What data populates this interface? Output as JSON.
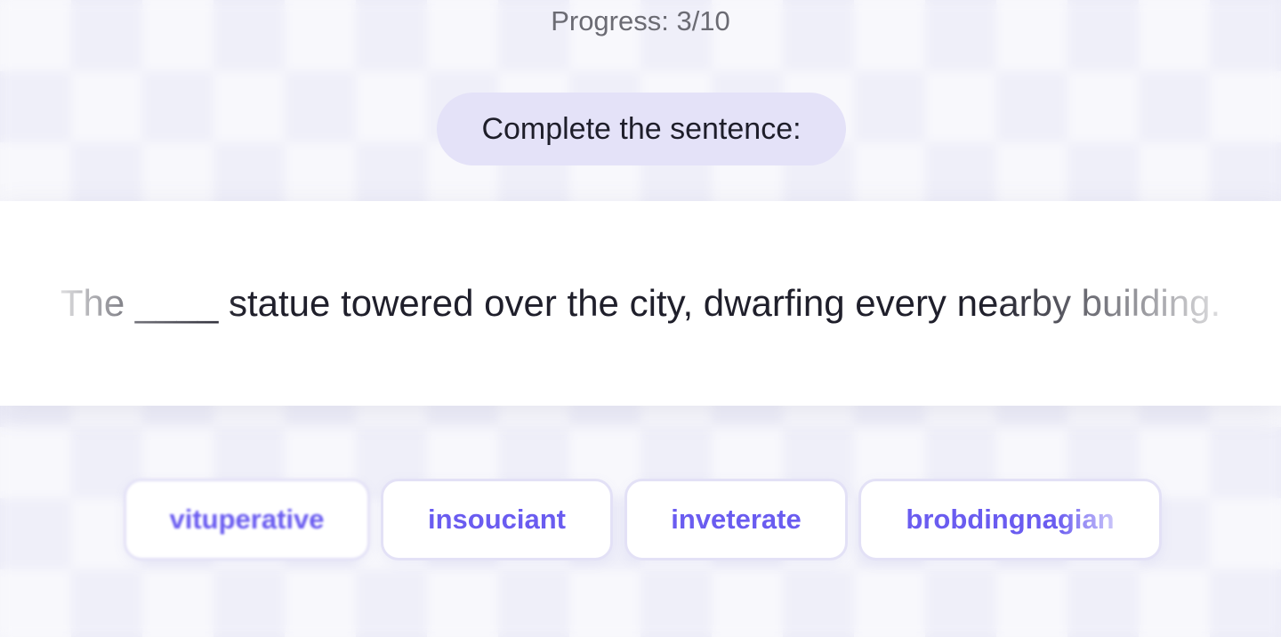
{
  "progress": {
    "text": "Progress: 3/10",
    "current": 3,
    "total": 10
  },
  "prompt": {
    "instruction": "Complete the sentence:"
  },
  "sentence": {
    "text": "The ____ statue towered over the city, dwarfing every nearby building."
  },
  "options": [
    {
      "label": "vituperative"
    },
    {
      "label": "insouciant"
    },
    {
      "label": "inveterate"
    },
    {
      "label": "brobdingnagian"
    }
  ],
  "colors": {
    "accent": "#6a5cf0",
    "pill_background": "#e4e2f8",
    "option_border": "#e3e1f6",
    "text_dark": "#1f1f2b",
    "text_muted": "#6b6b73"
  }
}
